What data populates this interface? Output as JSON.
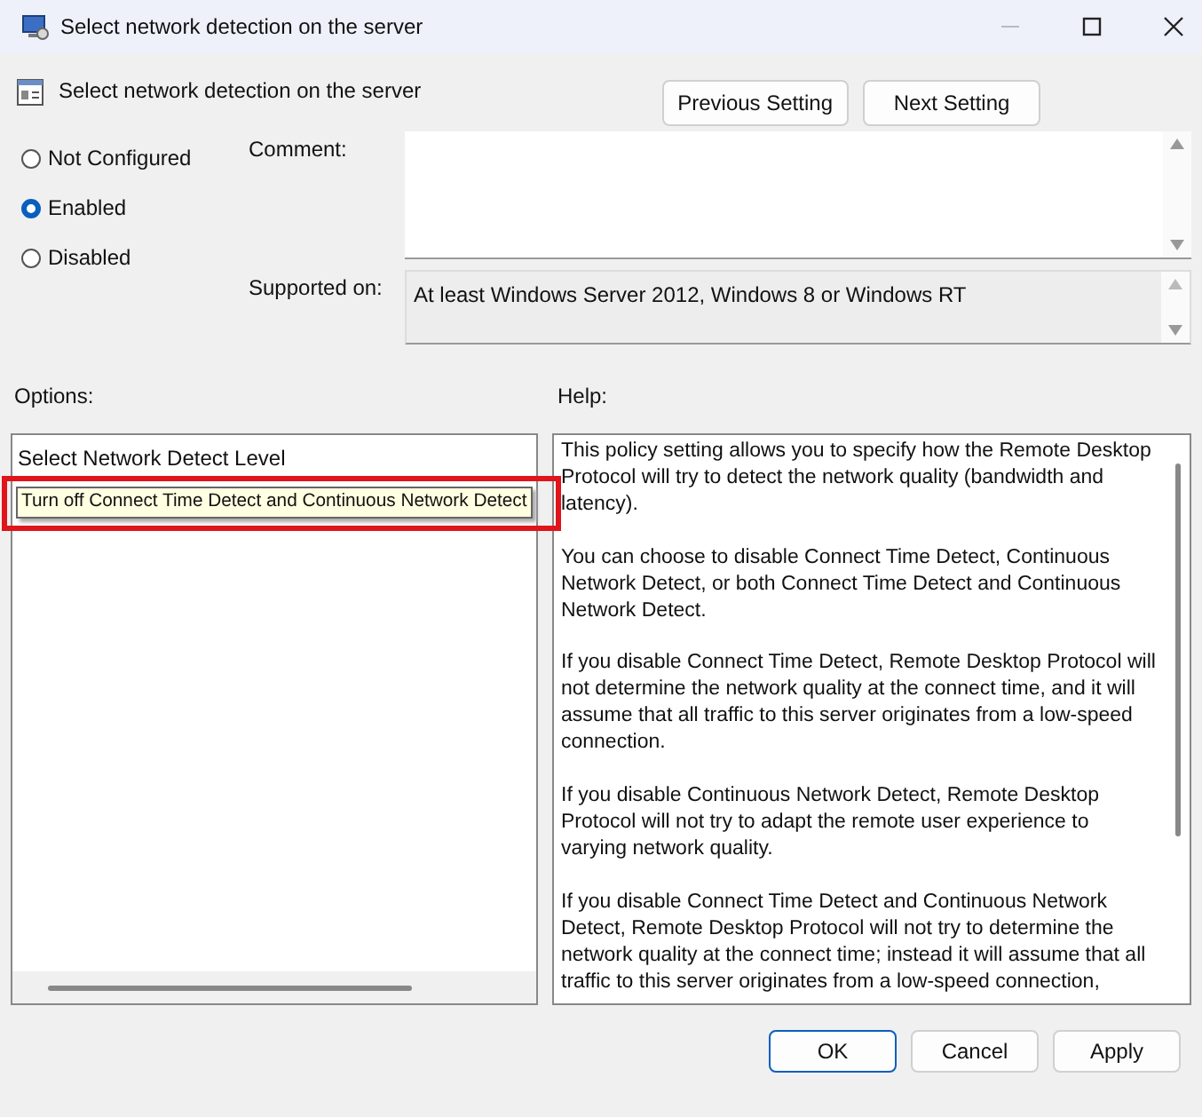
{
  "window": {
    "title": "Select network detection on the server"
  },
  "header": {
    "title": "Select network detection on the server",
    "buttons": [
      "Previous Setting",
      "Next Setting"
    ]
  },
  "states": [
    {
      "label": "Not Configured",
      "selected": false
    },
    {
      "label": "Enabled",
      "selected": true
    },
    {
      "label": "Disabled",
      "selected": false
    }
  ],
  "comment": {
    "label": "Comment:"
  },
  "supported": {
    "label": "Supported on:",
    "value": "At least Windows Server 2012, Windows 8 or Windows RT"
  },
  "options": {
    "label": "Options:",
    "field_label": "Select Network Detect Level",
    "tooltip": "Turn off Connect Time Detect and Continuous Network Detect"
  },
  "help": {
    "label": "Help:",
    "paragraphs": [
      "This policy setting allows you to specify how the Remote Desktop Protocol will try to detect the network quality (bandwidth and latency).",
      "You can choose to disable Connect Time Detect, Continuous Network Detect, or both Connect Time Detect and Continuous Network Detect.",
      "If you disable Connect Time Detect, Remote Desktop Protocol will not determine the network quality at the connect time, and it will assume that all traffic to this server originates from a low-speed connection.",
      "If you disable Continuous Network Detect, Remote Desktop Protocol will not try to adapt the remote user experience to varying network quality.",
      "If you disable Connect Time Detect and Continuous Network Detect, Remote Desktop Protocol will not try to determine the network quality at the connect time; instead it will assume that all traffic to this server originates from a low-speed connection,"
    ]
  },
  "buttons": [
    "OK",
    "Cancel",
    "Apply"
  ]
}
